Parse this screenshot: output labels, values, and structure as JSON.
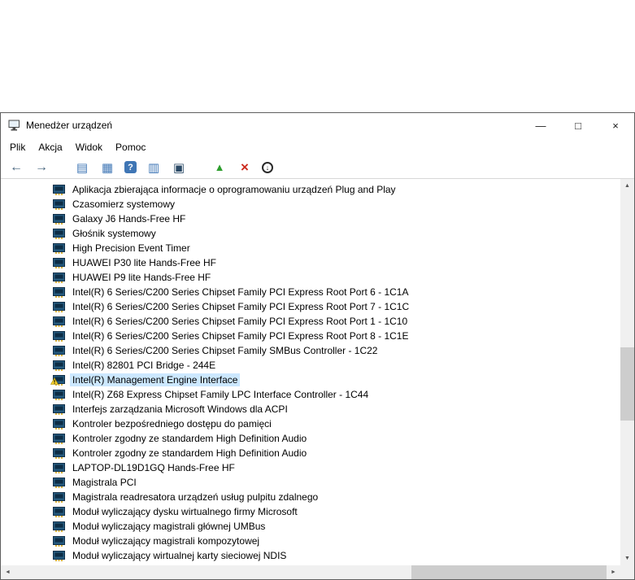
{
  "window": {
    "title": "Menedżer urządzeń",
    "controls": {
      "minimize": "—",
      "maximize": "□",
      "close": "×"
    }
  },
  "menu": {
    "items": [
      "Plik",
      "Akcja",
      "Widok",
      "Pomoc"
    ]
  },
  "toolbar": {
    "icons": [
      {
        "name": "back-icon",
        "glyph": "←"
      },
      {
        "name": "forward-icon",
        "glyph": "→"
      },
      {
        "name": "console-tree-icon",
        "glyph": "▤"
      },
      {
        "name": "properties-icon",
        "glyph": "▦"
      },
      {
        "name": "help-icon",
        "glyph": "?"
      },
      {
        "name": "scan-hardware-icon",
        "glyph": "▥"
      },
      {
        "name": "devices-monitor-icon",
        "glyph": "▣"
      },
      {
        "name": "update-driver-icon",
        "glyph": "▲"
      },
      {
        "name": "uninstall-icon",
        "glyph": "×"
      },
      {
        "name": "disable-device-icon",
        "glyph": "↓"
      }
    ]
  },
  "tree": {
    "items": [
      {
        "label": "Aplikacja zbierająca informacje o oprogramowaniu urządzeń Plug and Play"
      },
      {
        "label": "Czasomierz systemowy"
      },
      {
        "label": "Galaxy J6 Hands-Free HF"
      },
      {
        "label": "Głośnik systemowy"
      },
      {
        "label": "High Precision Event Timer"
      },
      {
        "label": "HUAWEI P30 lite Hands-Free HF"
      },
      {
        "label": "HUAWEI P9 lite Hands-Free HF"
      },
      {
        "label": "Intel(R) 6 Series/C200 Series Chipset Family PCI Express Root Port 6 - 1C1A"
      },
      {
        "label": "Intel(R) 6 Series/C200 Series Chipset Family PCI Express Root Port 7 - 1C1C"
      },
      {
        "label": "Intel(R) 6 Series/C200 Series Chipset Family PCI Express Root Port 1 - 1C10"
      },
      {
        "label": "Intel(R) 6 Series/C200 Series Chipset Family PCI Express Root Port 8 - 1C1E"
      },
      {
        "label": "Intel(R) 6 Series/C200 Series Chipset Family SMBus Controller - 1C22"
      },
      {
        "label": "Intel(R) 82801 PCI Bridge - 244E"
      },
      {
        "label": "Intel(R) Management Engine Interface",
        "warning": true,
        "selected": true
      },
      {
        "label": "Intel(R) Z68 Express Chipset Family LPC Interface Controller - 1C44"
      },
      {
        "label": "Interfejs zarządzania Microsoft Windows dla ACPI"
      },
      {
        "label": "Kontroler bezpośredniego dostępu do pamięci"
      },
      {
        "label": "Kontroler zgodny ze standardem High Definition Audio"
      },
      {
        "label": "Kontroler zgodny ze standardem High Definition Audio"
      },
      {
        "label": "LAPTOP-DL19D1GQ Hands-Free HF"
      },
      {
        "label": "Magistrala PCI"
      },
      {
        "label": "Magistrala readresatora urządzeń usług pulpitu zdalnego"
      },
      {
        "label": "Moduł wyliczający dysku wirtualnego firmy Microsoft"
      },
      {
        "label": "Moduł wyliczający magistrali głównej UMBus"
      },
      {
        "label": "Moduł wyliczający magistrali kompozytowej"
      },
      {
        "label": "Moduł wyliczający wirtualnej karty sieciowej NDIS"
      }
    ]
  },
  "scrollbar": {
    "up": "▲",
    "down": "▼",
    "left": "◄",
    "right": "►"
  },
  "colors": {
    "selection": "#cce8ff",
    "warning_yellow": "#f8d22a",
    "toolbar_blue": "#3f76b5",
    "uninstall_red": "#cc2a1e",
    "scrollbar_track": "#f0f0f0",
    "scrollbar_thumb": "#cdcdcd"
  }
}
